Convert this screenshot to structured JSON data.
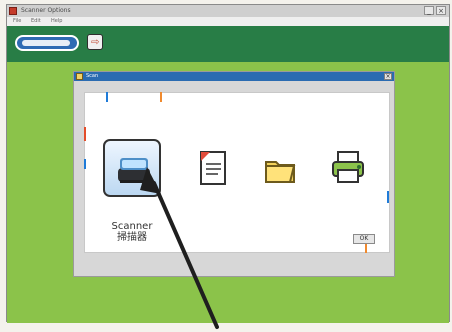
{
  "window": {
    "title": "Scanner Options",
    "buttons": [
      "_",
      "×"
    ]
  },
  "menubar": {
    "items": [
      "File",
      "Edit",
      "Help"
    ]
  },
  "dialog": {
    "title": "Scan",
    "close_glyph": "×",
    "items": [
      {
        "name": "scanner",
        "label_line1": "Scanner",
        "label_line2": "掃描器",
        "icon": "scanner-icon"
      },
      {
        "name": "document",
        "icon": "document-icon"
      },
      {
        "name": "folder",
        "icon": "folder-icon"
      },
      {
        "name": "printer",
        "icon": "printer-icon"
      }
    ],
    "ok_label": "OK"
  },
  "colors": {
    "toolbar": "#287d46",
    "background": "#8bc34a",
    "dialog_title": "#2a6bb1"
  }
}
